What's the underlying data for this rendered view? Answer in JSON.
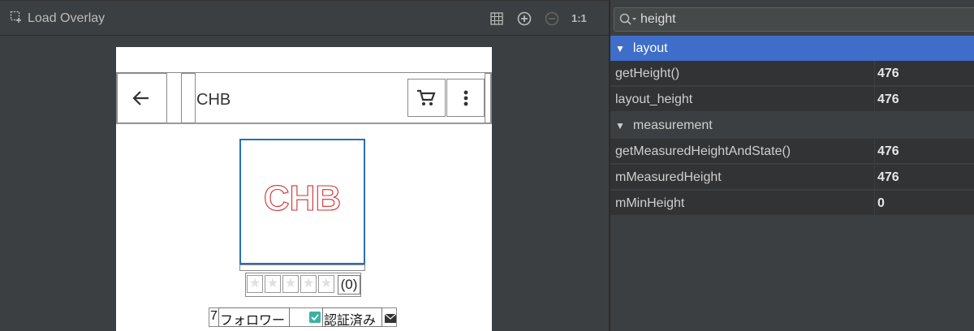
{
  "toolbar": {
    "load_overlay_label": "Load Overlay",
    "icons": [
      "grid-icon",
      "zoom-in-icon",
      "zoom-out-icon"
    ],
    "actual_size_label": "1:1"
  },
  "device": {
    "app_title": "CHB",
    "logo_text": "CHB",
    "rating_count": "(0)",
    "follow_digit": "7",
    "follow_label": "フォロワー",
    "verified_label": "認証済み"
  },
  "inspector": {
    "search": {
      "value": "height"
    },
    "groups": [
      {
        "name": "layout",
        "properties": [
          {
            "key": "getHeight()",
            "value": "476"
          },
          {
            "key": "layout_height",
            "value": "476"
          }
        ]
      },
      {
        "name": "measurement",
        "properties": [
          {
            "key": "getMeasuredHeightAndState()",
            "value": "476"
          },
          {
            "key": "mMeasuredHeight",
            "value": "476"
          },
          {
            "key": "mMinHeight",
            "value": "0"
          }
        ]
      }
    ]
  },
  "colors": {
    "selection": "#3e6ec9",
    "logo_red": "#d0302f",
    "logo_border": "#2a6fb5"
  }
}
